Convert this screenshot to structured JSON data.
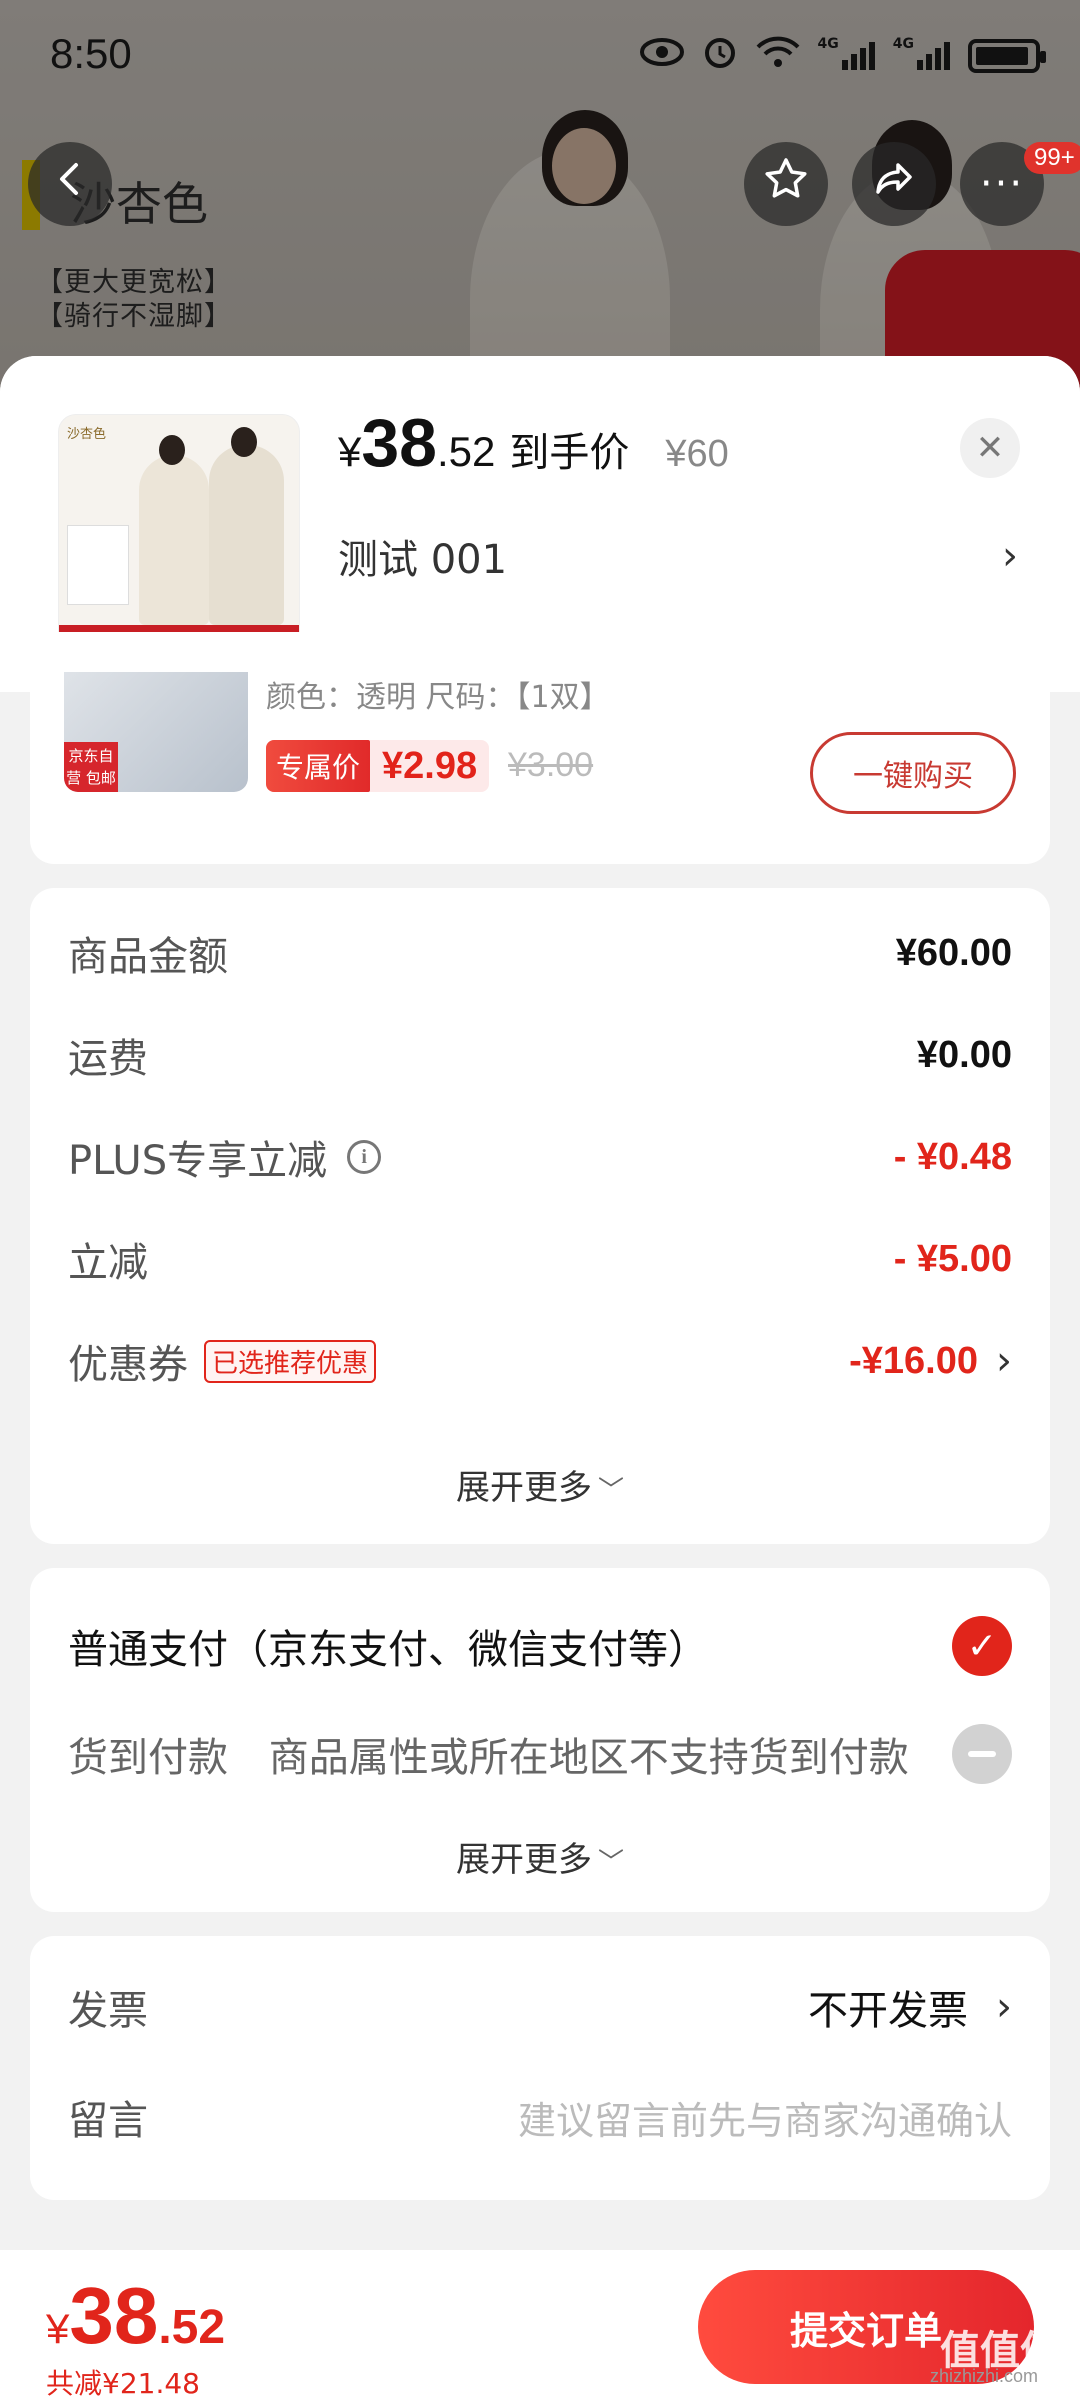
{
  "status_bar": {
    "time": "8:50",
    "signal1": "4G",
    "signal2": "4G"
  },
  "background": {
    "brand": "沙杏色",
    "tag1": "【更大更宽松】",
    "tag2": "【骑行不湿脚】",
    "more_badge": "99+"
  },
  "header": {
    "price_symbol": "¥",
    "price_int": "38",
    "price_dec": ".52",
    "price_label": "到手价",
    "original_price": "¥60",
    "variant": "测试   001"
  },
  "addon": {
    "image_label": "京东自营 包邮",
    "attrs": "颜色：透明   尺码：【1双】",
    "exclusive_tag": "专属价",
    "exclusive_price": "¥2.98",
    "orig_price": "¥3.00",
    "buy_label": "一键购买"
  },
  "breakdown": {
    "rows": [
      {
        "label": "商品金额",
        "amount": "¥60.00"
      },
      {
        "label": "运费",
        "amount": "¥0.00"
      },
      {
        "label": "PLUS专享立减",
        "amount": "- ¥0.48"
      },
      {
        "label": "立减",
        "amount": "- ¥5.00"
      },
      {
        "label": "优惠券",
        "amount": "-¥16.00",
        "tag": "已选推荐优惠"
      }
    ],
    "expand": "展开更多"
  },
  "payment": {
    "normal": "普通支付（京东支付、微信支付等）",
    "cod_label": "货到付款",
    "cod_note": "商品属性或所在地区不支持货到付款",
    "expand": "展开更多"
  },
  "invoice": {
    "label": "发票",
    "value": "不开发票",
    "note_label": "留言",
    "note_placeholder": "建议留言前先与商家沟通确认"
  },
  "footer": {
    "total_symbol": "¥",
    "total_int": "38",
    "total_dec": ".52",
    "saved": "共减¥21.48",
    "submit": "提交订单",
    "watermark": "值值值",
    "watermark_url": "zhizhizhi.com"
  },
  "colors": {
    "accent": "#e1251b",
    "sheet_bg": "#f2f2f2"
  }
}
